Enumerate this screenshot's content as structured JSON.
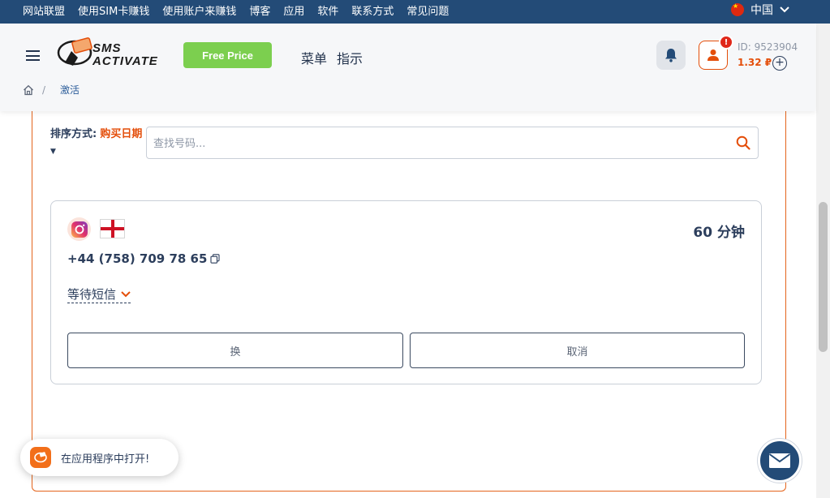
{
  "topnav": {
    "items": [
      "网站联盟",
      "使用SIM卡赚钱",
      "使用账户来赚钱",
      "博客",
      "应用",
      "软件",
      "联系方式",
      "常见问题"
    ],
    "language": "中国"
  },
  "header": {
    "logo_top": "SMS",
    "logo_bottom": "ACTIVATE",
    "free_price_label": "Free Price",
    "menu_label": "菜单",
    "guide_label": "指示",
    "notification_badge": "!",
    "account_id": "ID: 9523904",
    "balance": "1.32 ₽",
    "add_balance": "+",
    "breadcrumb_current": "激活"
  },
  "sort": {
    "label": "排序方式:",
    "value": "购买日期"
  },
  "search": {
    "placeholder": "查找号码..."
  },
  "activation": {
    "service": "instagram-icon",
    "country_flag": "england-flag",
    "timer": "60 分钟",
    "phone": "+44 (758) 709 78 65",
    "status": "等待短信",
    "replace_label": "换",
    "cancel_label": "取消"
  },
  "open_app": {
    "label": "在应用程序中打开!"
  },
  "colors": {
    "topbar": "#234b77",
    "accent": "#e44e0a",
    "free_price": "#7ccf4f",
    "text": "#2c3e5c"
  }
}
